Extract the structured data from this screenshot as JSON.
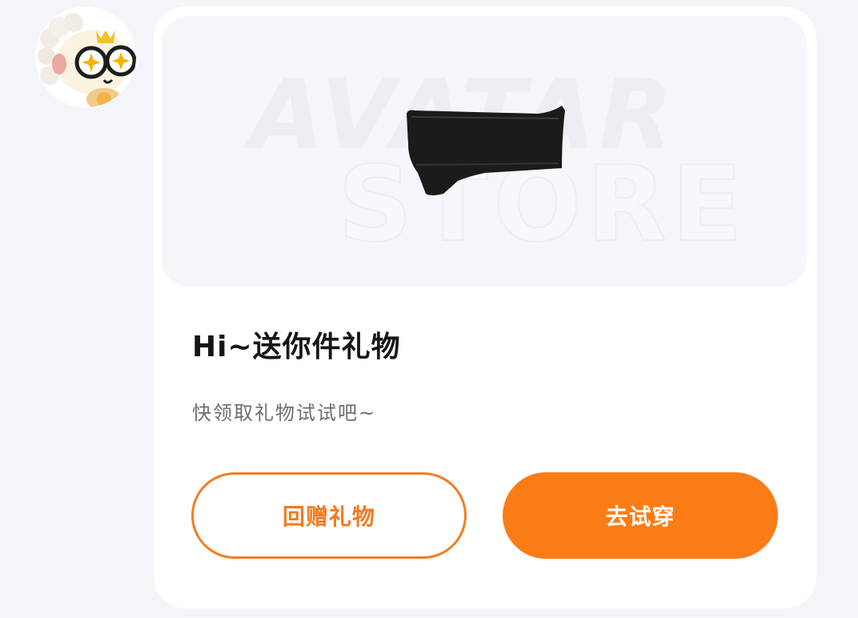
{
  "sender": {
    "avatar_icon": "cartoon-sheep-avatar-icon"
  },
  "gift_card": {
    "banner_watermark_line1": "AVATAR",
    "banner_watermark_line2": "STORE",
    "gift_item_icon": "black-headband-icon",
    "title": "Hi~送你件礼物",
    "subtitle": "快领取礼物试试吧~",
    "return_gift_label": "回赠礼物",
    "try_on_label": "去试穿"
  },
  "colors": {
    "accent": "#fa7c17",
    "outline_accent": "#f37c21",
    "page_background": "#f4f5f9",
    "card_background": "#ffffff",
    "banner_background": "#f5f6fa"
  }
}
